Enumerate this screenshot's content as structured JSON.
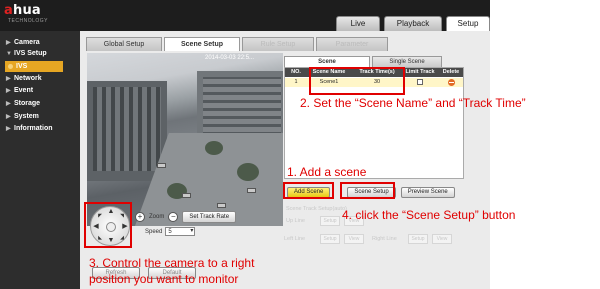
{
  "app": {
    "logo_a": "a",
    "logo_rest": "hua",
    "logo_sub": "TECHNOLOGY",
    "brand_color": "#e00000"
  },
  "top_tabs": [
    {
      "label": "Live"
    },
    {
      "label": "Playback"
    },
    {
      "label": "Setup"
    }
  ],
  "sidebar": {
    "items": [
      {
        "label": "Camera"
      },
      {
        "label": "IVS Setup"
      },
      {
        "label": "Network"
      },
      {
        "label": "Event"
      },
      {
        "label": "Storage"
      },
      {
        "label": "System"
      },
      {
        "label": "Information"
      }
    ],
    "active_sub": "IVS",
    "active_color": "#e6a623"
  },
  "sub_tabs": [
    {
      "label": "Global Setup",
      "state": "normal"
    },
    {
      "label": "Scene Setup",
      "state": "active"
    },
    {
      "label": "Rule Setup",
      "state": "disabled"
    },
    {
      "label": "Parameter",
      "state": "disabled"
    }
  ],
  "video": {
    "timestamp": "2014-03-03 22:5..."
  },
  "scene_panel": {
    "tabs": [
      "Scene",
      "Single Scene"
    ],
    "columns": [
      "NO.",
      "Scene Name",
      "Track Time(s)",
      "Limit Track",
      "Delete"
    ],
    "rows": [
      {
        "no": "1",
        "name": "Scene1",
        "track_time": "30"
      }
    ],
    "buttons": {
      "add": "Add Scene",
      "setup": "Scene Setup",
      "preview": "Preview Scene"
    },
    "track_section_label": "Scene Track Setup(auto)",
    "up_line": "Up Line",
    "left_line": "Left Line",
    "right_line": "Right Line",
    "setup_btn": "Setup",
    "view_btn": "View"
  },
  "ptz": {
    "zoom_label": "Zoom",
    "set_track_rate": "Set Track Rate",
    "speed_label": "Speed",
    "speed_value": "5",
    "bottom_btn_1": "Refresh",
    "bottom_btn_2": "Default"
  },
  "annotations": {
    "step1": "1. Add a scene",
    "step2": "2. Set the “Scene Name” and “Track Time”",
    "step3_line1": "3. Control the camera to a right",
    "step3_line2": "position you want to monitor",
    "step4": "4. click the “Scene Setup” button",
    "annotation_color": "#e00000"
  }
}
